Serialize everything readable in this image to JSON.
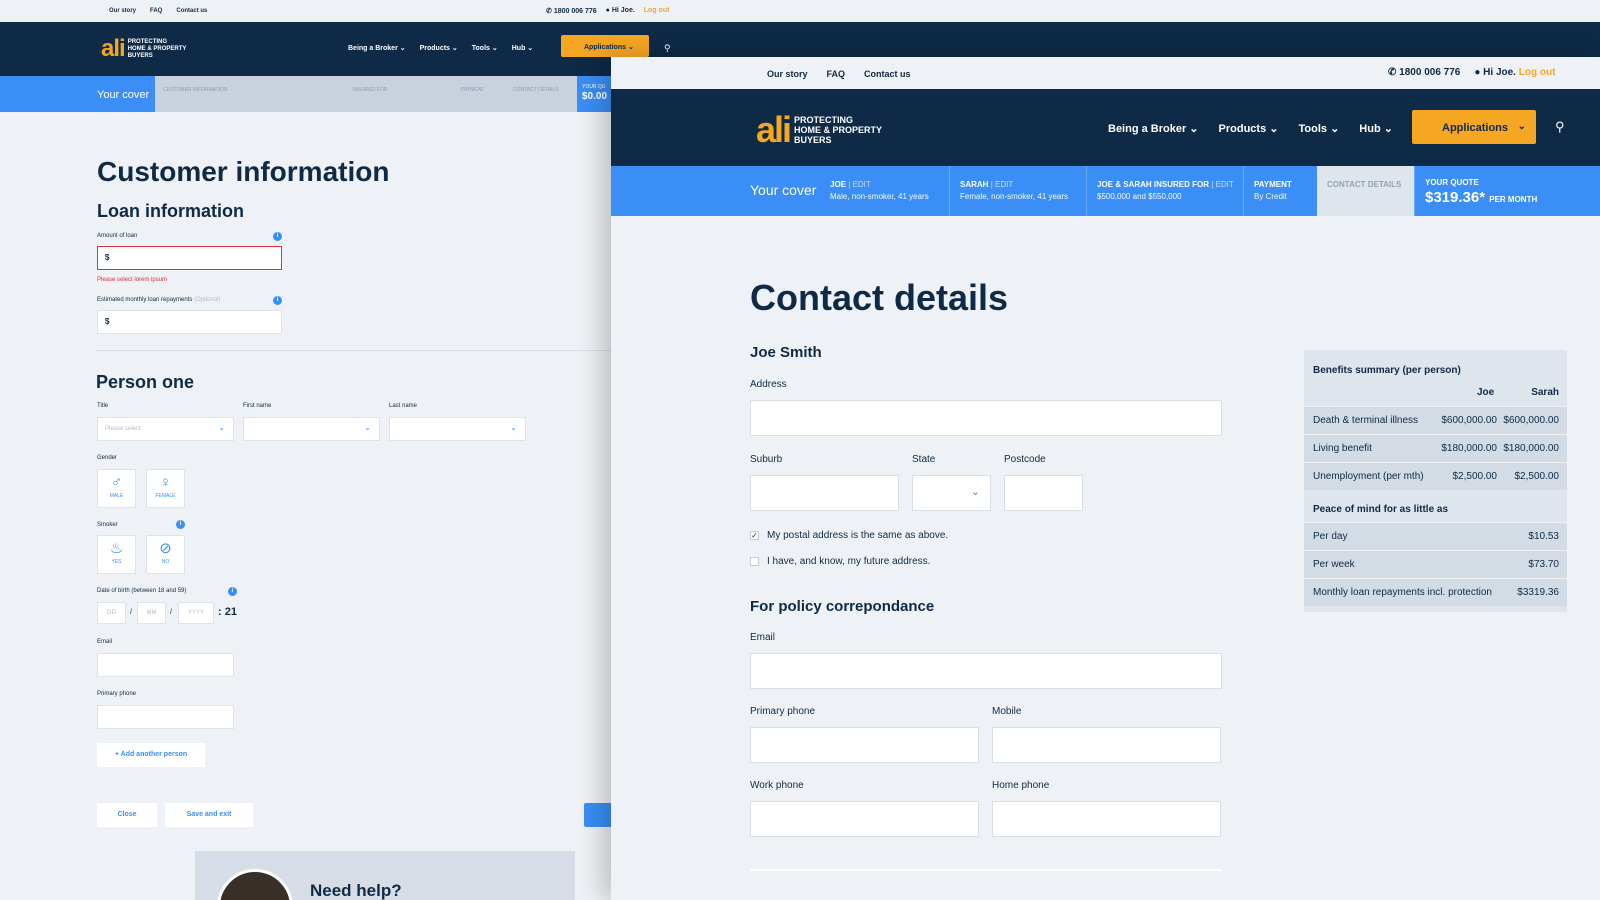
{
  "back": {
    "util": {
      "links": [
        "Our story",
        "FAQ",
        "Contact us"
      ],
      "phone": "1800 006 776",
      "greeting": "Hi Joe.",
      "logout": "Log out"
    },
    "nav": {
      "logo": "ali",
      "logo_text": [
        "PROTECTING",
        "HOME & PROPERTY",
        "BUYERS"
      ],
      "links": [
        "Being a Broker",
        "Products",
        "Tools",
        "Hub"
      ],
      "applications": "Applications"
    },
    "progress": {
      "your_cover": "Your cover",
      "steps": [
        "CUSTOMER INFORMATION",
        "INSURED FOR",
        "PAYMENT",
        "CONTACT DETAILS"
      ],
      "quote_label": "YOUR QU",
      "quote_value": "$0.00"
    },
    "title": "Customer information",
    "loan": {
      "heading": "Loan information",
      "amount_label": "Amount of loan",
      "amount_prefix": "$",
      "error": "Please select lorem ipsum",
      "monthly_label": "Estimated monthly loan repayments",
      "optional": "(Optional)",
      "monthly_prefix": "$"
    },
    "person": {
      "heading": "Person one",
      "title_label": "Title",
      "title_placeholder": "Please select",
      "first_label": "First name",
      "last_label": "Last name",
      "gender_label": "Gender",
      "male": "MALE",
      "female": "FEMALE",
      "smoker_label": "Smoker",
      "yes": "YES",
      "no": "NO",
      "dob_label": "Date of birth (between 18 and 59)",
      "dd": "DD",
      "mm": "MM",
      "yyyy": "YYYY",
      "age": "21",
      "email_label": "Email",
      "phone_label": "Primary phone",
      "add_person": "+ Add another person"
    },
    "buttons": {
      "close": "Close",
      "save_exit": "Save and exit"
    },
    "help": "Need help?"
  },
  "front": {
    "util": {
      "links": [
        "Our story",
        "FAQ",
        "Contact us"
      ],
      "phone": "1800 006 776",
      "greeting": "Hi Joe.",
      "logout": "Log out"
    },
    "nav": {
      "logo": "ali",
      "logo_text": [
        "PROTECTING",
        "HOME & PROPERTY",
        "BUYERS"
      ],
      "links": [
        "Being a Broker",
        "Products",
        "Tools",
        "Hub"
      ],
      "applications": "Applications"
    },
    "progress": {
      "your_cover": "Your cover",
      "steps": [
        {
          "head": "JOE",
          "edit": "EDIT",
          "sub": "Male, non-smoker, 41 years"
        },
        {
          "head": "SARAH",
          "edit": "EDIT",
          "sub": "Female, non-smoker, 41 years"
        },
        {
          "head": "JOE & SARAH INSURED FOR",
          "edit": "EDIT",
          "sub": "$500,000 and $550,000"
        },
        {
          "head": "PAYMENT",
          "edit": "",
          "sub": "By Credit"
        }
      ],
      "current": "CONTACT DETAILS",
      "quote_label": "YOUR QUOTE",
      "quote_value": "$319.36*",
      "quote_period": "PER MONTH"
    },
    "title": "Contact details",
    "person_name": "Joe Smith",
    "fields": {
      "address": "Address",
      "suburb": "Suburb",
      "state": "State",
      "postcode": "Postcode",
      "postal_same": "My postal address is the same as above.",
      "future_address": "I have, and know, my future address.",
      "policy_heading": "For policy correpondance",
      "email": "Email",
      "primary_phone": "Primary phone",
      "mobile": "Mobile",
      "work_phone": "Work phone",
      "home_phone": "Home phone"
    },
    "summary": {
      "heading": "Benefits summary (per person)",
      "cols": [
        "Joe",
        "Sarah"
      ],
      "rows": [
        {
          "name": "Death & terminal illness",
          "joe": "$600,000.00",
          "sarah": "$600,000.00"
        },
        {
          "name": "Living benefit",
          "joe": "$180,000.00",
          "sarah": "$180,000.00"
        },
        {
          "name": "Unemployment (per mth)",
          "joe": "$2,500.00",
          "sarah": "$2,500.00"
        }
      ],
      "peace_heading": "Peace of mind for as little as",
      "peace_rows": [
        {
          "name": "Per day",
          "value": "$10.53"
        },
        {
          "name": "Per week",
          "value": "$73.70"
        },
        {
          "name": "Monthly loan repayments incl. protection",
          "value": "$3319.36"
        }
      ]
    }
  }
}
